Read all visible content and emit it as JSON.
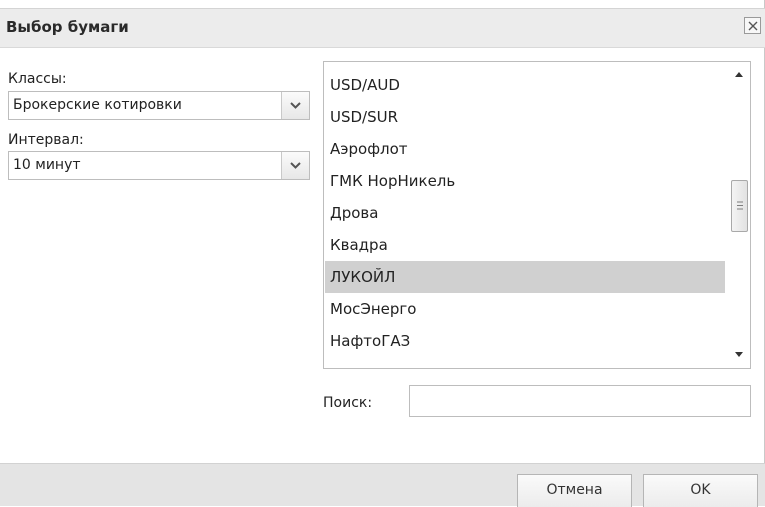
{
  "dialog": {
    "title": "Выбор бумаги",
    "close_icon": "close-icon"
  },
  "classes": {
    "label": "Классы:",
    "value": "Брокерские котировки"
  },
  "interval": {
    "label": "Интервал:",
    "value": "10 минут"
  },
  "securities": {
    "items": [
      "USD/AUD",
      "USD/SUR",
      "Аэрофлот",
      "ГМК НорНикель",
      "Дрова",
      "Квадра",
      "ЛУКОЙЛ",
      "МосЭнерго",
      "НафтоГАЗ"
    ],
    "selected": "ЛУКОЙЛ"
  },
  "search": {
    "label": "Поиск:",
    "value": ""
  },
  "buttons": {
    "cancel": "Отмена",
    "ok": "OK"
  },
  "colors": {
    "selected_row": "#d0d0d0",
    "titlebar": "#ececec",
    "footer": "#e4e4e4"
  }
}
